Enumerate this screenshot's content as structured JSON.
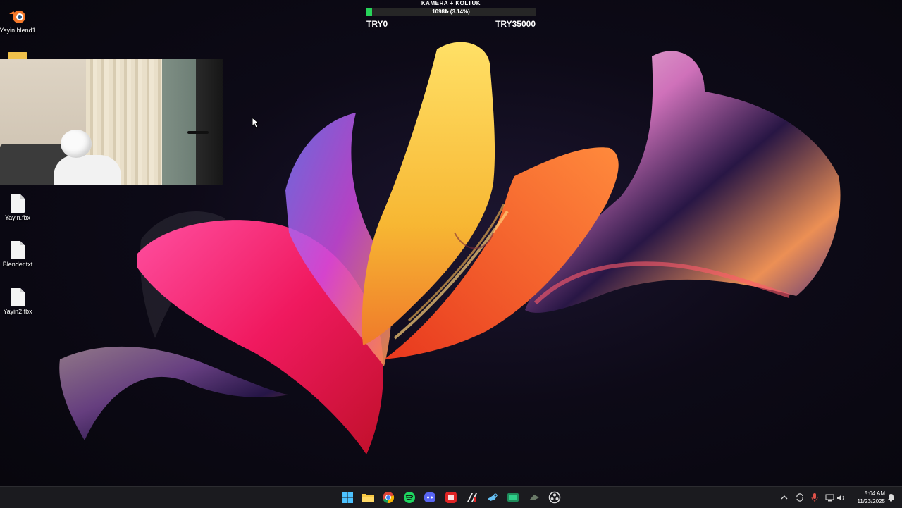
{
  "desktop": {
    "icons": [
      {
        "label": "Yayin.blend1",
        "icon": "blender-icon"
      },
      {
        "label": "Yayin.fbx",
        "icon": "file-icon"
      },
      {
        "label": "Blender.txt",
        "icon": "text-file-icon"
      },
      {
        "label": "Yayin2.fbx",
        "icon": "file-icon"
      }
    ]
  },
  "donation_goal": {
    "title": "KAMERA + KOLTUK",
    "progress_text": "1098₺ (3.14%)",
    "progress_fraction": 0.0314,
    "start_label": "TRY0",
    "end_label": "TRY35000",
    "bar_color": "#27d35a"
  },
  "taskbar": {
    "apps": [
      {
        "name": "Start",
        "icon": "windows-start-icon"
      },
      {
        "name": "File Explorer",
        "icon": "folder-icon"
      },
      {
        "name": "Chrome",
        "icon": "chrome-icon"
      },
      {
        "name": "Spotify",
        "icon": "spotify-icon"
      },
      {
        "name": "Discord",
        "icon": "discord-icon"
      },
      {
        "name": "App",
        "icon": "red-app-icon"
      },
      {
        "name": "Stream",
        "icon": "stream-app-icon"
      },
      {
        "name": "Steam",
        "icon": "steam-icon"
      },
      {
        "name": "Game",
        "icon": "green-game-icon"
      },
      {
        "name": "App",
        "icon": "gray-app-icon"
      },
      {
        "name": "OBS",
        "icon": "obs-icon"
      }
    ],
    "tray": {
      "icons": [
        "chevron-up-icon",
        "sync-icon",
        "microphone-icon",
        "network-icon",
        "volume-icon"
      ],
      "time": "5:04 AM",
      "date": "11/23/2025"
    }
  }
}
